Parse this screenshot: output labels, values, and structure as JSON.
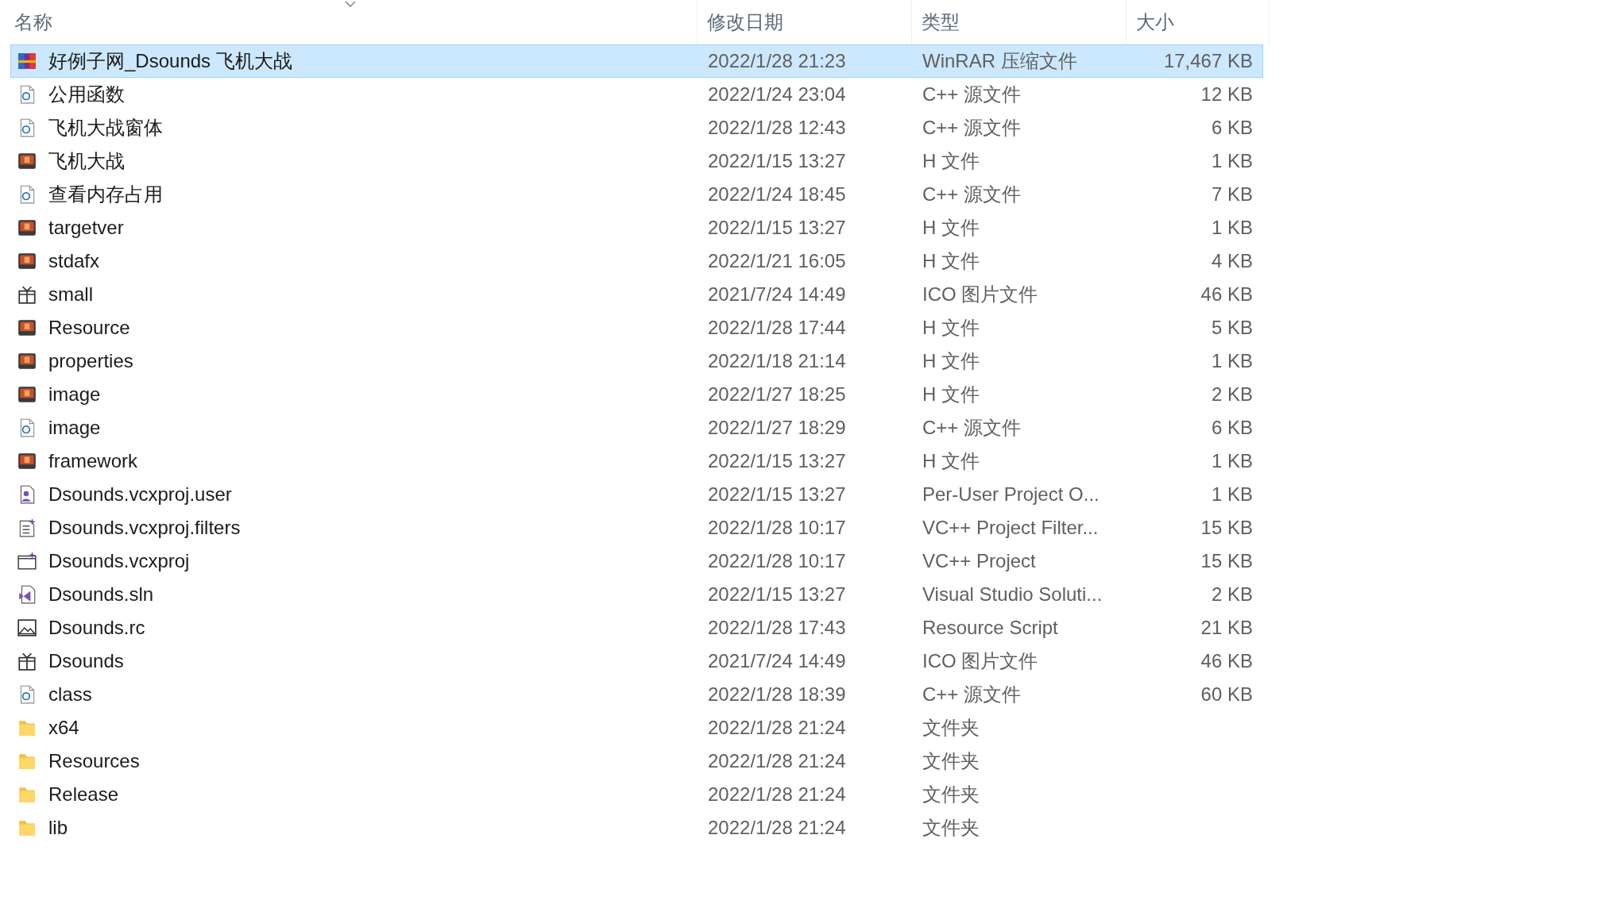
{
  "columns": [
    {
      "label": "名称"
    },
    {
      "label": "修改日期"
    },
    {
      "label": "类型"
    },
    {
      "label": "大小"
    }
  ],
  "rows": [
    {
      "name": "好例子网_Dsounds 飞机大战",
      "date": "2022/1/28 21:23",
      "type": "WinRAR 压缩文件",
      "size": "17,467 KB",
      "kind": "archive",
      "selected": true
    },
    {
      "name": "公用函数",
      "date": "2022/1/24 23:04",
      "type": "C++ 源文件",
      "size": "12 KB",
      "kind": "cpp",
      "selected": false
    },
    {
      "name": "飞机大战窗体",
      "date": "2022/1/28 12:43",
      "type": "C++ 源文件",
      "size": "6 KB",
      "kind": "cpp",
      "selected": false
    },
    {
      "name": "飞机大战",
      "date": "2022/1/15 13:27",
      "type": "H 文件",
      "size": "1 KB",
      "kind": "header",
      "selected": false
    },
    {
      "name": "查看内存占用",
      "date": "2022/1/24 18:45",
      "type": "C++ 源文件",
      "size": "7 KB",
      "kind": "cpp",
      "selected": false
    },
    {
      "name": "targetver",
      "date": "2022/1/15 13:27",
      "type": "H 文件",
      "size": "1 KB",
      "kind": "header",
      "selected": false
    },
    {
      "name": "stdafx",
      "date": "2022/1/21 16:05",
      "type": "H 文件",
      "size": "4 KB",
      "kind": "header",
      "selected": false
    },
    {
      "name": "small",
      "date": "2021/7/24 14:49",
      "type": "ICO 图片文件",
      "size": "46 KB",
      "kind": "ico",
      "selected": false
    },
    {
      "name": "Resource",
      "date": "2022/1/28 17:44",
      "type": "H 文件",
      "size": "5 KB",
      "kind": "header",
      "selected": false
    },
    {
      "name": "properties",
      "date": "2022/1/18 21:14",
      "type": "H 文件",
      "size": "1 KB",
      "kind": "header",
      "selected": false
    },
    {
      "name": "image",
      "date": "2022/1/27 18:25",
      "type": "H 文件",
      "size": "2 KB",
      "kind": "header",
      "selected": false
    },
    {
      "name": "image",
      "date": "2022/1/27 18:29",
      "type": "C++ 源文件",
      "size": "6 KB",
      "kind": "cpp",
      "selected": false
    },
    {
      "name": "framework",
      "date": "2022/1/15 13:27",
      "type": "H 文件",
      "size": "1 KB",
      "kind": "header",
      "selected": false
    },
    {
      "name": "Dsounds.vcxproj.user",
      "date": "2022/1/15 13:27",
      "type": "Per-User Project O...",
      "size": "1 KB",
      "kind": "user",
      "selected": false
    },
    {
      "name": "Dsounds.vcxproj.filters",
      "date": "2022/1/28 10:17",
      "type": "VC++ Project Filter...",
      "size": "15 KB",
      "kind": "filters",
      "selected": false
    },
    {
      "name": "Dsounds.vcxproj",
      "date": "2022/1/28 10:17",
      "type": "VC++ Project",
      "size": "15 KB",
      "kind": "project",
      "selected": false
    },
    {
      "name": "Dsounds.sln",
      "date": "2022/1/15 13:27",
      "type": "Visual Studio Soluti...",
      "size": "2 KB",
      "kind": "solution",
      "selected": false
    },
    {
      "name": "Dsounds.rc",
      "date": "2022/1/28 17:43",
      "type": "Resource Script",
      "size": "21 KB",
      "kind": "rc",
      "selected": false
    },
    {
      "name": "Dsounds",
      "date": "2021/7/24 14:49",
      "type": "ICO 图片文件",
      "size": "46 KB",
      "kind": "ico",
      "selected": false
    },
    {
      "name": "class",
      "date": "2022/1/28 18:39",
      "type": "C++ 源文件",
      "size": "60 KB",
      "kind": "cpp",
      "selected": false
    },
    {
      "name": "x64",
      "date": "2022/1/28 21:24",
      "type": "文件夹",
      "kind": "folder",
      "selected": false
    },
    {
      "name": "Resources",
      "date": "2022/1/28 21:24",
      "type": "文件夹",
      "kind": "folder",
      "selected": false
    },
    {
      "name": "Release",
      "date": "2022/1/28 21:24",
      "type": "文件夹",
      "kind": "folder",
      "selected": false
    },
    {
      "name": "lib",
      "date": "2022/1/28 21:24",
      "type": "文件夹",
      "kind": "folder",
      "selected": false
    }
  ]
}
